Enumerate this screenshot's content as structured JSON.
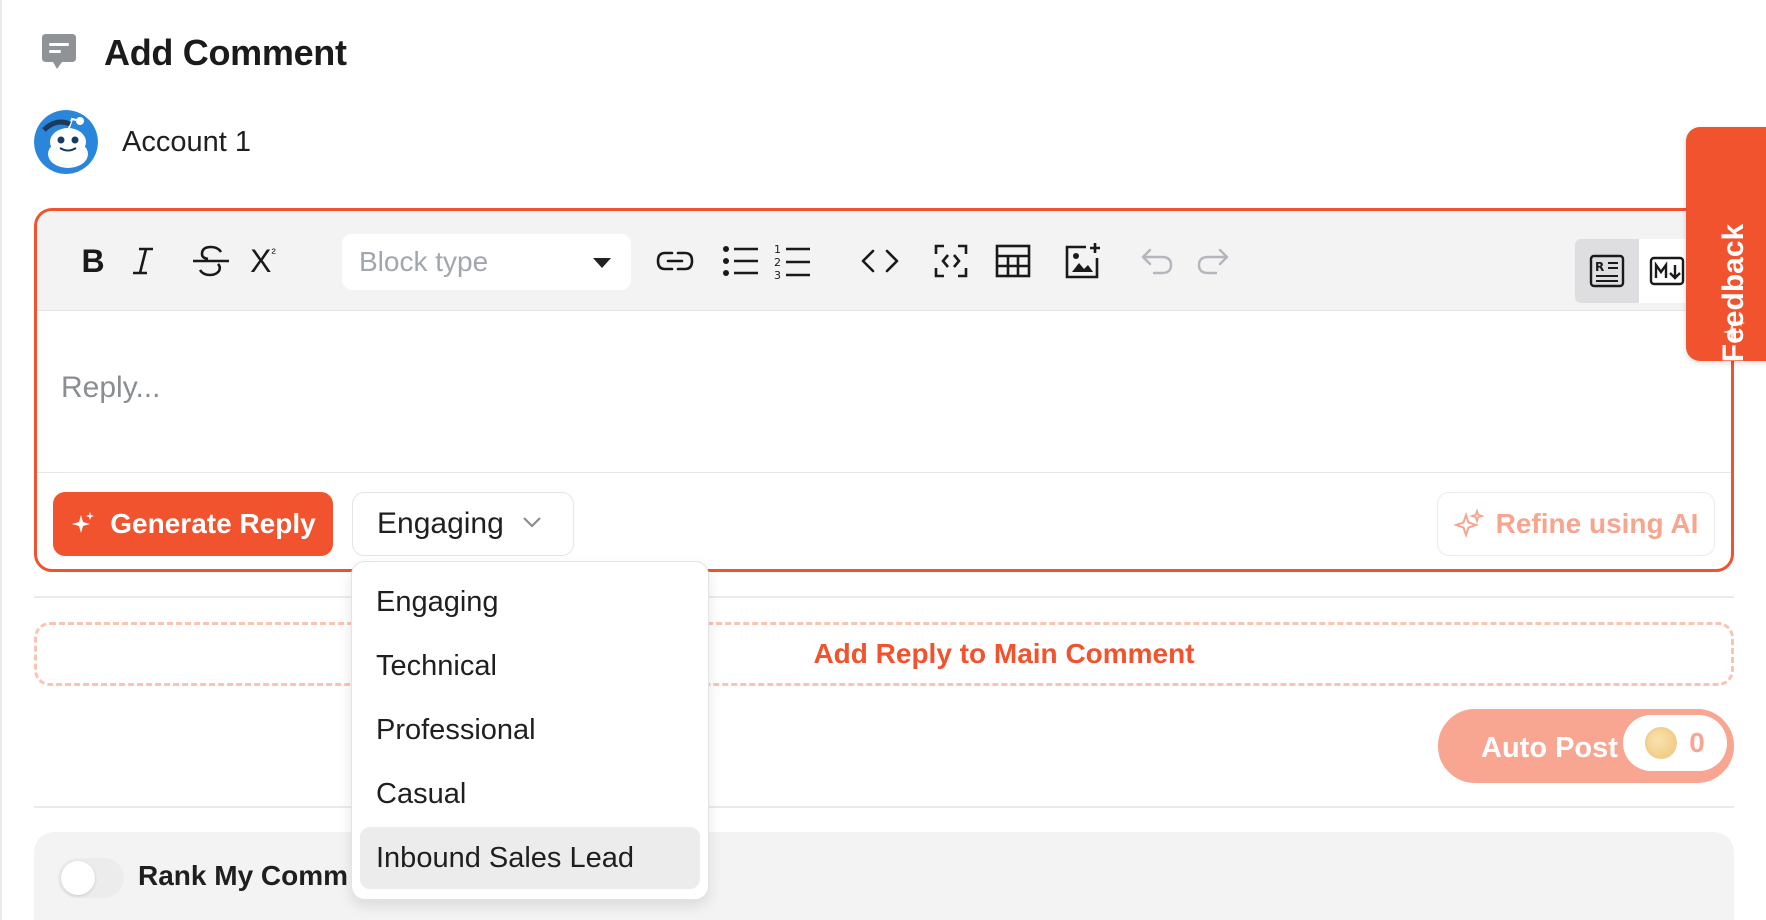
{
  "header": {
    "title": "Add Comment",
    "icon": "comment-icon"
  },
  "account": {
    "name": "Account 1",
    "avatar_icon": "reddit-snoo-avatar"
  },
  "editor": {
    "toolbar": {
      "bold": "B",
      "italic": "I",
      "strikethrough": "S",
      "superscript": "X",
      "block_type_placeholder": "Block type",
      "icons": [
        "link-icon",
        "bullet-list-icon",
        "numbered-list-icon",
        "code-icon",
        "code-block-icon",
        "table-icon",
        "image-icon",
        "undo-icon",
        "redo-icon",
        "rich-text-mode-icon",
        "markdown-mode-icon"
      ]
    },
    "placeholder": "Reply...",
    "generate_label": "Generate Reply",
    "tone_selected": "Engaging",
    "refine_label": "Refine using AI"
  },
  "feedback": {
    "label": "Feedback"
  },
  "add_reply": {
    "label": "Add Reply to Main Comment"
  },
  "autopost": {
    "label": "Auto Post",
    "count": "0"
  },
  "rank": {
    "label": "Rank My Comm"
  },
  "tone_menu": {
    "options": [
      "Engaging",
      "Technical",
      "Professional",
      "Casual",
      "Inbound Sales Lead"
    ],
    "highlighted": "Inbound Sales Lead"
  },
  "colors": {
    "accent": "#f0532d",
    "accent_light": "#f8a591",
    "toolbar_bg": "#f3f3f4"
  }
}
